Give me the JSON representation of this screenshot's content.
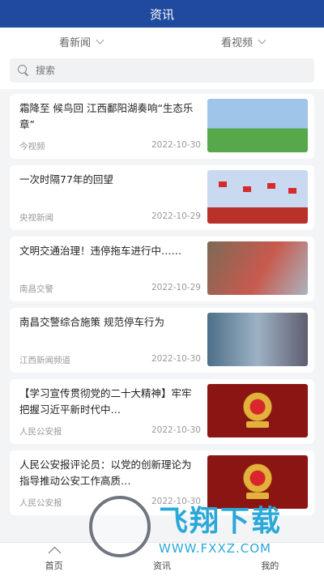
{
  "header": {
    "title": "资讯"
  },
  "subtabs": [
    {
      "label": "看新闻"
    },
    {
      "label": "看视频"
    }
  ],
  "search": {
    "placeholder": "搜索"
  },
  "news": [
    {
      "title": "霜降至 候鸟回 江西鄱阳湖奏响“生态乐章”",
      "source": "今视频",
      "date": "2022-10-30"
    },
    {
      "title": "一次时隔77年的回望",
      "source": "央视新闻",
      "date": "2022-10-29"
    },
    {
      "title": "文明交通治理！违停拖车进行中……",
      "source": "南昌交警",
      "date": "2022-10-29"
    },
    {
      "title": "南昌交警综合施策 规范停车行为",
      "source": "江西新闻频道",
      "date": "2022-10-30"
    },
    {
      "title": "【学习宣传贯彻党的二十大精神】牢牢把握习近平新时代中…",
      "source": "人民公安报",
      "date": "2022-10-30"
    },
    {
      "title": "人民公安报评论员：以党的创新理论为指导推动公安工作高质…",
      "source": "人民公安报",
      "date": "2022-10-30"
    }
  ],
  "tabbar": [
    {
      "label": "首页",
      "icon": "home-icon"
    },
    {
      "label": "资讯"
    },
    {
      "label": "我的"
    }
  ],
  "watermark": {
    "brand": "飞翔下载",
    "url": "WWW.FXXZ.COM"
  },
  "colors": {
    "header": "#1f4a9e",
    "watermark": "#2aa8d8"
  }
}
